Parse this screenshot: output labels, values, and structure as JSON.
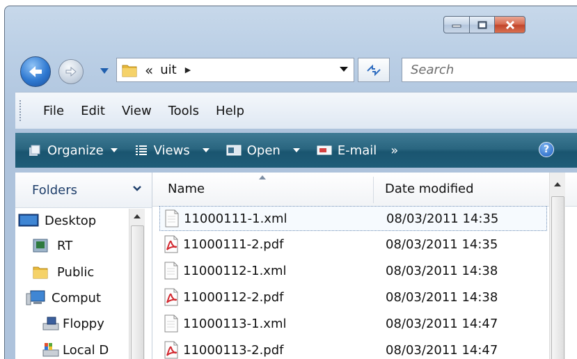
{
  "address": {
    "chevron": "«",
    "path": "uit",
    "arrow": "▶"
  },
  "search": {
    "placeholder": "Search"
  },
  "menu": [
    "File",
    "Edit",
    "View",
    "Tools",
    "Help"
  ],
  "toolbar": {
    "organize": "Organize",
    "views": "Views",
    "open": "Open",
    "email": "E-mail",
    "more": "»",
    "help": "?"
  },
  "folders": {
    "title": "Folders",
    "items": [
      "Desktop",
      "RT",
      "Public",
      "Comput",
      "Floppy",
      "Local D"
    ]
  },
  "columns": {
    "name": "Name",
    "date": "Date modified"
  },
  "files": [
    {
      "name": "11000111-1.xml",
      "date": "08/03/2011 14:35",
      "type": "xml",
      "selected": true
    },
    {
      "name": "11000111-2.pdf",
      "date": "08/03/2011 14:35",
      "type": "pdf",
      "selected": false
    },
    {
      "name": "11000112-1.xml",
      "date": "08/03/2011 14:38",
      "type": "xml",
      "selected": false
    },
    {
      "name": "11000112-2.pdf",
      "date": "08/03/2011 14:38",
      "type": "pdf",
      "selected": false
    },
    {
      "name": "11000113-1.xml",
      "date": "08/03/2011 14:47",
      "type": "xml",
      "selected": false
    },
    {
      "name": "11000113-2.pdf",
      "date": "08/03/2011 14:47",
      "type": "pdf",
      "selected": false
    }
  ],
  "colors": {
    "toolbar_dark": "#1a5570",
    "window_frame": "#b4c9e1",
    "pdf_red": "#d2272e",
    "close_red": "#c1452a"
  }
}
